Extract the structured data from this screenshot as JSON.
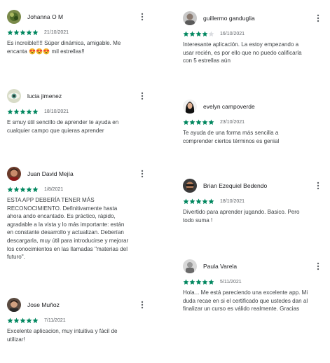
{
  "colors": {
    "star_filled": "#01875f",
    "star_empty": "#dadce0"
  },
  "reviews": [
    {
      "name": "Johanna O M",
      "rating": 5,
      "date": "21/10/2021",
      "text": "Es increible!!!! Súper dinámica, amigable. Me\nencanta 😍😍😍 mil estrellas!!",
      "avatar_icon": "plant-photo-avatar"
    },
    {
      "name": "guillermo ganduglia",
      "rating": 4,
      "date": "16/10/2021",
      "text": "Interesante aplicación. La estoy empezando a\nusar recién, es por ello que no puedo calificarla\ncon 5 estrellas aún",
      "avatar_icon": "person-photo-avatar"
    },
    {
      "name": "lucia jimenez",
      "rating": 5,
      "date": "18/10/2021",
      "text": "E smuy útil sencillo de aprender te ayuda en\ncualquier campo que quieras aprender",
      "avatar_icon": "eye-photo-avatar"
    },
    {
      "name": "evelyn campoverde",
      "rating": 5,
      "date": "23/10/2021",
      "text": "Te ayuda de una forma más sencilla a\ncomprender ciertos términos es genial",
      "avatar_icon": "woman-photo-avatar"
    },
    {
      "name": "Juan David Mejía",
      "rating": 5,
      "date": "1/8/2021",
      "text": "ESTA APP DEBERÍA TENER MÁS\nRECONOCIMIENTO. Definitivamente hasta\nahora ando encantado. Es práctico, rápido,\nagradable a la vista y lo más importante: están\nen constante desarrollo y actualizan. Deberían\ndescargarla, muy útil para introducirse y mejorar\nlos conocimientos en las llamadas \"materias del\nfuturo\".",
      "avatar_icon": "man-photo-avatar"
    },
    {
      "name": "Brian Ezequiel Bedendo",
      "rating": 5,
      "date": "18/10/2021",
      "text": "Divertido para aprender jugando. Basico. Pero\ntodo suma !",
      "avatar_icon": "man-photo-avatar"
    },
    {
      "name": "Paula Varela",
      "rating": 5,
      "date": "5/11/2021",
      "text": "Hola... Me está pareciendo una excelente app. Mi\nduda recae en si el certificado que ustedes dan al\nfinalizar un curso es válido realmente. Gracias",
      "avatar_icon": "person-photo-avatar"
    },
    {
      "name": "Jose Muñoz",
      "rating": 5,
      "date": "7/11/2021",
      "text": "Excelente aplicacion, muy intuitiva y fácil de\nutilizar!",
      "avatar_icon": "man-photo-avatar"
    }
  ]
}
